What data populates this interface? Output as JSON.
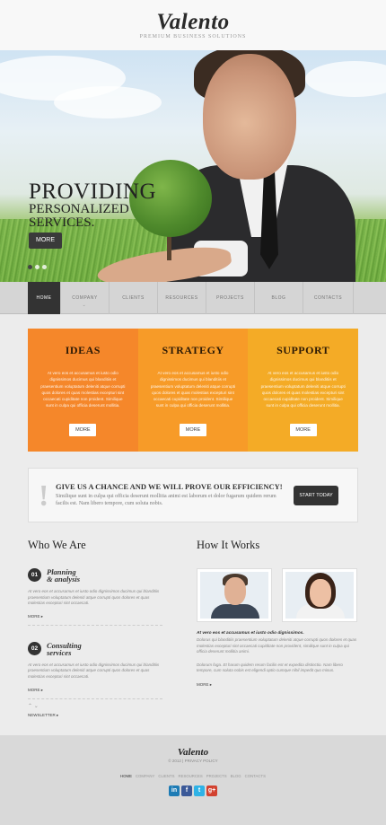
{
  "header": {
    "logo": "Valento",
    "tagline": "PREMIUM BUSINESS SOLUTIONS"
  },
  "hero": {
    "line1": "PROVIDING",
    "line2": "PERSONALIZED",
    "line3": "SERVICES.",
    "more_label": "MORE",
    "slide_count": 3,
    "active_slide": 1
  },
  "nav": {
    "items": [
      "HOME",
      "COMPANY",
      "CLIENTS",
      "RESOURCES",
      "PROJECTS",
      "BLOG",
      "CONTACTS"
    ]
  },
  "features": [
    {
      "title": "IDEAS",
      "text": "At vero eos et accusamus et iusto odio dignissimos ducimus qui blanditiis et praesentium voluptatum deleniti atque corrupti quos dolores et quas molestias excepturi sint occaecati cupiditate non proident. Similique sunt in culpa qui officia deserunt mollitia.",
      "button": "MORE",
      "color": "#f5872a"
    },
    {
      "title": "STRATEGY",
      "text": "At vero eos et accusamus et iusto odio dignissimos ducimus qui blanditiis et praesentium voluptatum deleniti atque corrupti quos dolores et quas molestias excepturi sint occaecati cupiditate non proident. Similique sunt in culpa qui officia deserunt mollitia.",
      "button": "MORE",
      "color": "#f79b28"
    },
    {
      "title": "SUPPORT",
      "text": "At vero eos et accusamus et iusto odio dignissimos ducimus qui blanditiis et praesentium voluptatum deleniti atque corrupti quos dolores et quas molestias excepturi sint occaecati cupiditate non proident. Similique sunt in culpa qui officia deserunt mollitia.",
      "button": "MORE",
      "color": "#f4ab26"
    }
  ],
  "efficiency": {
    "title": "GIVE US A CHANCE AND WE WILL PROVE OUR EFFICIENCY!",
    "text": "Similique sunt in culpa qui officia deserunt mollitia animi est laborum et dolor fugarum quidem rerum facilis est. Nam libero tempore, cum soluta nobis.",
    "button": "START TODAY"
  },
  "who": {
    "title": "Who We Are",
    "steps": [
      {
        "num": "01",
        "title1": "Planning",
        "title2": "& analysis",
        "text": "At vero eos et accusamus et iusto odio dignissimos ducimus qui blanditiis praesentium voluptatum deleniti atque corrupti quos dolores et quas molestias excepturi sint occaecati.",
        "more": "MORE"
      },
      {
        "num": "02",
        "title1": "Consulting",
        "title2": "services",
        "text": "At vero eos et accusamus et iusto odio dignissimos ducimus qui blanditiis praesentium voluptatum deleniti atque corrupti quos dolores et quas molestias excepturi sint occaecati.",
        "more": "MORE"
      }
    ],
    "newsletter": "NEWSLETTER"
  },
  "how": {
    "title": "How It Works",
    "bold": "At vero eos et accusamus et iusto odio dignissimos.",
    "text1": "Dolorus qui blanditiis praesentium voluptatum deleniti atque corrupti quos dolores et quas molestias excepturi sint occaecati cupiditate non provident, similique sunt in culpa qui officia deserunt mollitia animi.",
    "text2": "Dolorum fuga. Et harum quidem rerum facilis est et expedita distinctio. Nam libero tempore, cum soluta nobis est eligendi optio cumque nihil impedit quo minus.",
    "more": "MORE"
  },
  "footer": {
    "logo": "Valento",
    "copy": "© 2012 | PRIVACY POLICY",
    "nav": [
      "HOME",
      "COMPANY",
      "CLIENTS",
      "RESOURCES",
      "PROJECTS",
      "BLOG",
      "CONTACTS"
    ],
    "social": [
      {
        "icon": "linkedin-icon",
        "glyph": "in"
      },
      {
        "icon": "facebook-icon",
        "glyph": "f"
      },
      {
        "icon": "twitter-icon",
        "glyph": "t"
      },
      {
        "icon": "google-plus-icon",
        "glyph": "g+"
      }
    ]
  }
}
